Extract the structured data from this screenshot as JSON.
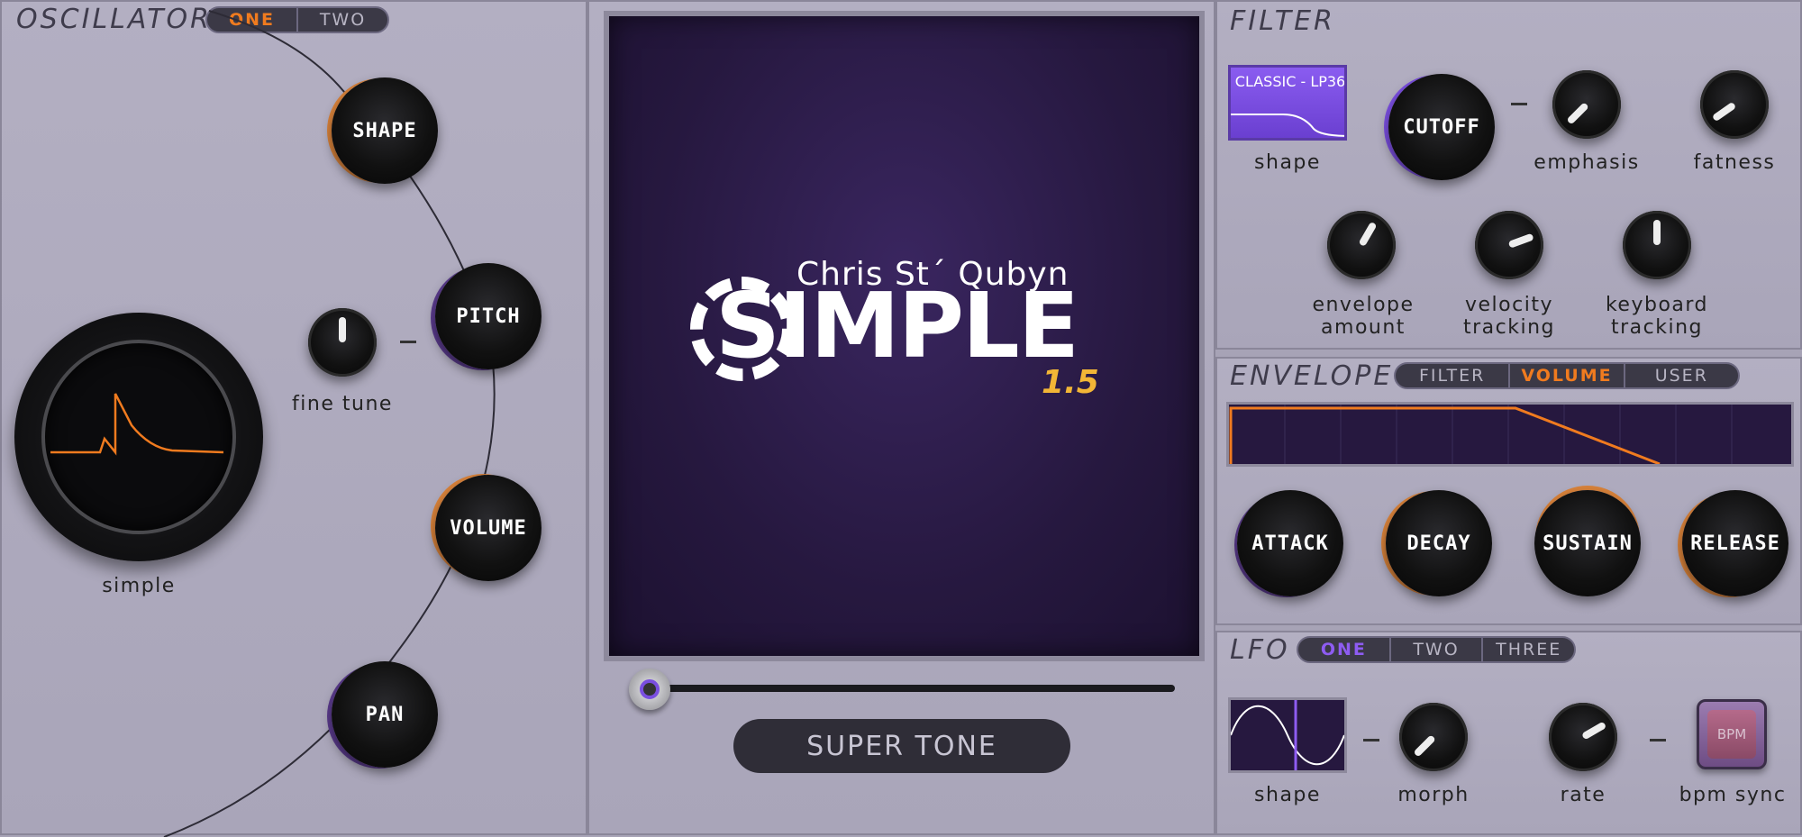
{
  "oscillator": {
    "title": "OSCILLATOR",
    "tabs": [
      {
        "label": "ONE",
        "active": true
      },
      {
        "label": "TWO",
        "active": false
      }
    ],
    "knobs": {
      "shape": "SHAPE",
      "pitch": "PITCH",
      "volume": "VOLUME",
      "pan": "PAN"
    },
    "fine_tune_label": "fine tune",
    "wave_label": "simple"
  },
  "display": {
    "author": "Chris St´ Qubyn",
    "product": "SIMPLE",
    "version": "1.5",
    "preset_name": "SUPER TONE"
  },
  "filter": {
    "title": "FILTER",
    "shape_name": "CLASSIC - LP36",
    "shape_label": "shape",
    "cutoff_label": "CUTOFF",
    "emphasis_label": "emphasis",
    "fatness_label": "fatness",
    "envelope_amount_label": "envelope\namount",
    "velocity_tracking_label": "velocity\ntracking",
    "keyboard_tracking_label": "keyboard\ntracking"
  },
  "envelope": {
    "title": "ENVELOPE",
    "tabs": [
      {
        "label": "FILTER",
        "active": false
      },
      {
        "label": "VOLUME",
        "active": true
      },
      {
        "label": "USER",
        "active": false
      }
    ],
    "knobs": {
      "attack": "ATTACK",
      "decay": "DECAY",
      "sustain": "SUSTAIN",
      "release": "RELEASE"
    }
  },
  "lfo": {
    "title": "LFO",
    "tabs": [
      {
        "label": "ONE",
        "active": true
      },
      {
        "label": "TWO",
        "active": false
      },
      {
        "label": "THREE",
        "active": false
      }
    ],
    "shape_label": "shape",
    "morph_label": "morph",
    "rate_label": "rate",
    "bpm_sync_label": "bpm sync",
    "bpm_button": "BPM"
  },
  "colors": {
    "accent_orange": "#f07b1f",
    "accent_purple": "#7a4ee0",
    "display_bg": "#2a1b46"
  }
}
